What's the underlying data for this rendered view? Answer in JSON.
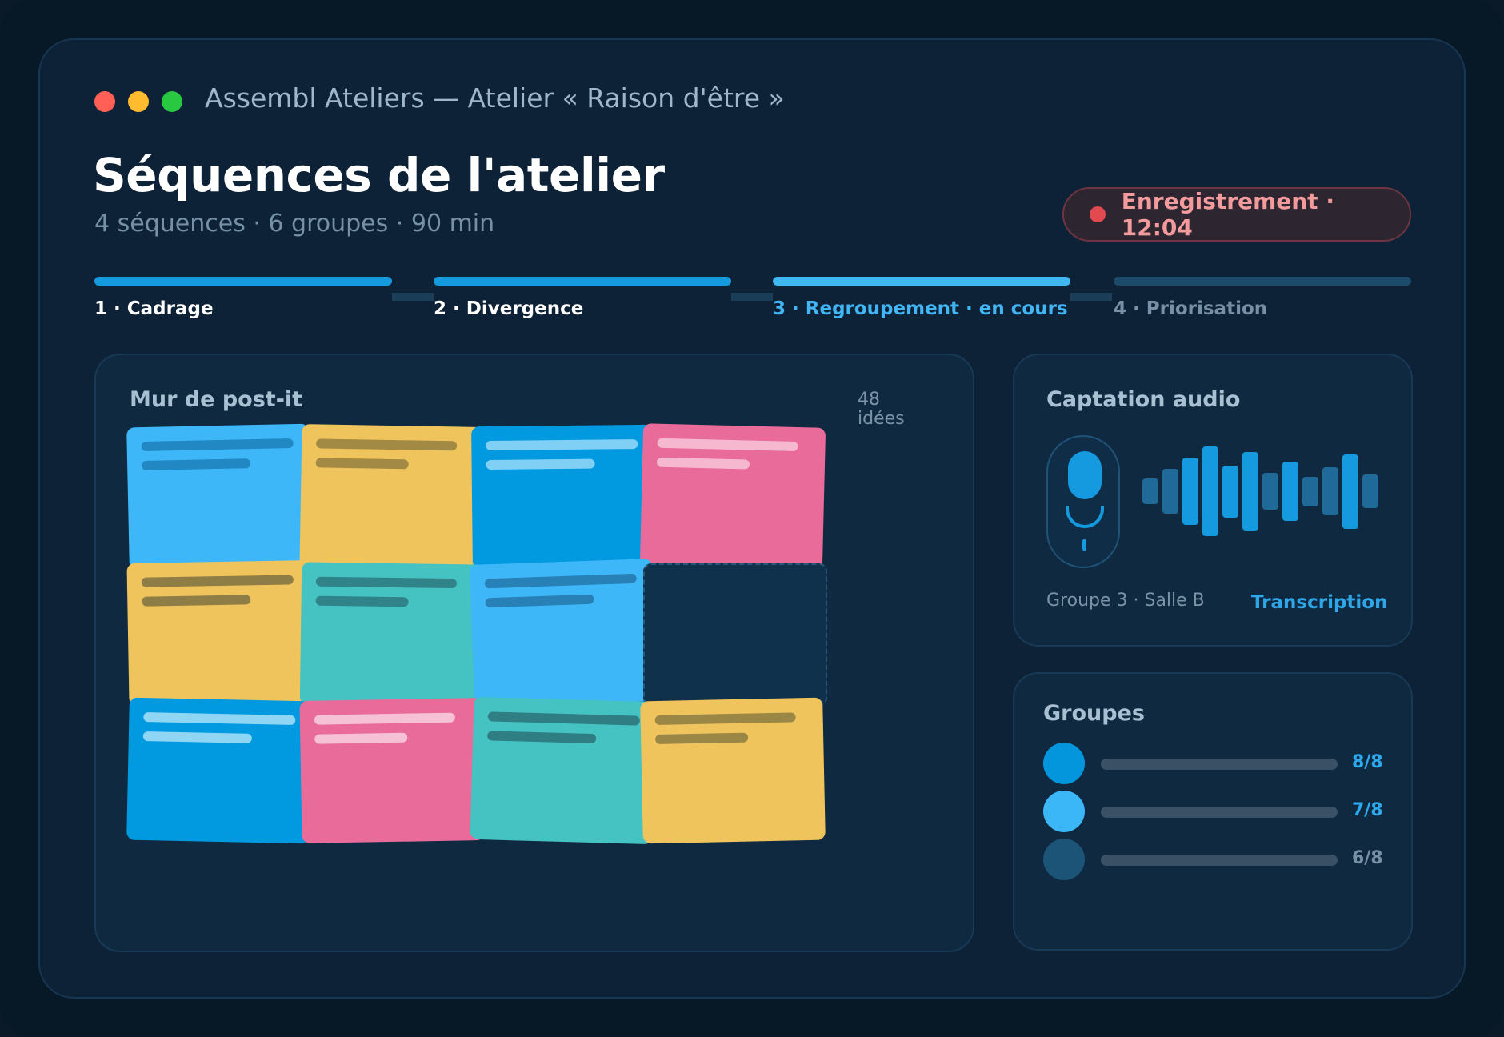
{
  "window": {
    "title": "Assembl Ateliers — Atelier « Raison d'être »",
    "traffic_lights": [
      {
        "name": "close",
        "color": "#ff5f57"
      },
      {
        "name": "minimize",
        "color": "#febc2e"
      },
      {
        "name": "zoom",
        "color": "#28c840"
      }
    ]
  },
  "header": {
    "title": "Séquences de l'atelier",
    "subtitle": "4 séquences · 6 groupes · 90 min",
    "recording": {
      "label": "Enregistrement · 12:04",
      "dot_color": "#e34a4f"
    }
  },
  "steps": [
    {
      "label": "1 · Cadrage",
      "state": "done",
      "bar_color": "#1599df",
      "text_color": "#ffffff"
    },
    {
      "label": "2 · Divergence",
      "state": "done",
      "bar_color": "#1599df",
      "text_color": "#ffffff"
    },
    {
      "label": "3 · Regroupement · en cours",
      "state": "current",
      "bar_color": "#3fb8f2",
      "text_color": "#42b6f5"
    },
    {
      "label": "4 · Priorisation",
      "state": "todo",
      "bar_color": "#1c4a6a",
      "text_color": "#7890a5"
    }
  ],
  "wall": {
    "title": "Mur de post-it",
    "count": "48 idées",
    "notes": [
      {
        "color": "#3eb7f9",
        "line_color": "#2188c4"
      },
      {
        "color": "#f0c45c",
        "line_color": "#a38a44"
      },
      {
        "color": "#019ae0",
        "line_color": "#7fd0f4"
      },
      {
        "color": "#e86b9a",
        "line_color": "#f5b8cf"
      },
      {
        "color": "#f0c45c",
        "line_color": "#8f7d46"
      },
      {
        "color": "#45c2c2",
        "line_color": "#2f8389"
      },
      {
        "color": "#3eb7f9",
        "line_color": "#2780b6"
      },
      {
        "color": "empty",
        "line_color": ""
      },
      {
        "color": "#019ae0",
        "line_color": "#8fd5f4"
      },
      {
        "color": "#e86b9a",
        "line_color": "#f7c1d5"
      },
      {
        "color": "#45c2c2",
        "line_color": "#2e7e84"
      },
      {
        "color": "#f0c45c",
        "line_color": "#9b8745"
      }
    ]
  },
  "audio": {
    "title": "Captation audio",
    "location": "Groupe 3 · Salle B",
    "link": "Transcription",
    "mic_icon": "microphone-icon",
    "levels": [
      0.15,
      0.4,
      0.7,
      1.0,
      0.5,
      0.85,
      0.3,
      0.6,
      0.2,
      0.45,
      0.8,
      0.25
    ]
  },
  "groups": {
    "title": "Groupes",
    "rows": [
      {
        "count": "8/8",
        "avatar_color": "#0396dd",
        "count_color": "#2ea9ee"
      },
      {
        "count": "7/8",
        "avatar_color": "#3bb6f7",
        "count_color": "#2ea9ee"
      },
      {
        "count": "6/8",
        "avatar_color": "#1c5478",
        "count_color": "#7890a5"
      }
    ]
  }
}
